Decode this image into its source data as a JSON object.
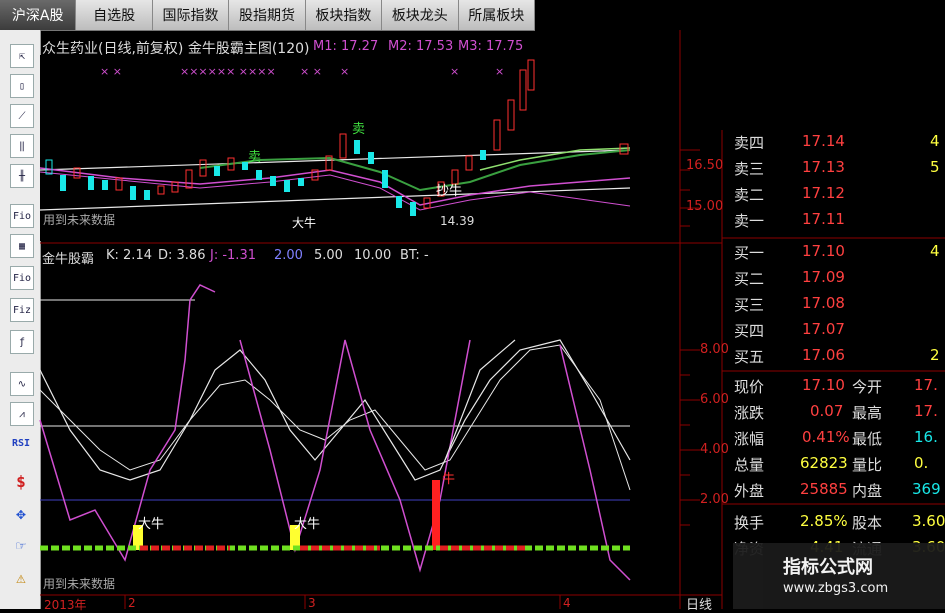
{
  "tabs": [
    "沪深A股",
    "自选股",
    "国际指数",
    "股指期货",
    "板块指数",
    "板块龙头",
    "所属板块"
  ],
  "toolbar": {
    "fio1": "Fio",
    "fio2": "Fio",
    "fiz": "Fiz",
    "rsi": "RSI"
  },
  "main_chart": {
    "title": "众生药业(日线,前复权) 金牛股霸主图(120)",
    "m1": "M1: 17.27",
    "m2": "M2: 17.53",
    "m3": "M3: 17.75",
    "axis_labels": [
      "16.50",
      "15.00"
    ],
    "marker_sell1": "卖",
    "marker_sell2": "卖",
    "marker_buy": "抄牛",
    "marker_big_bull": "大牛",
    "low_price": "14.39",
    "future_note": "用到未来数据"
  },
  "indicator": {
    "name": "金牛股霸",
    "k": "K: 2.14",
    "d": "D: 3.86",
    "j": "J: -1.31",
    "v2": "2.00",
    "v5": "5.00",
    "v10": "10.00",
    "bt": "BT: -",
    "axis_labels": [
      "8.00",
      "6.00",
      "4.00",
      "2.00"
    ],
    "signals": [
      "大牛",
      "大牛",
      "牛"
    ],
    "future_note": "用到未来数据"
  },
  "date_axis": {
    "year": "2013年",
    "m2": "2",
    "m3": "3",
    "m4": "4",
    "period": "日线"
  },
  "quote": {
    "asks": [
      {
        "label": "卖四",
        "price": "17.14",
        "vol": "4"
      },
      {
        "label": "卖三",
        "price": "17.13",
        "vol": "5"
      },
      {
        "label": "卖二",
        "price": "17.12",
        "vol": ""
      },
      {
        "label": "卖一",
        "price": "17.11",
        "vol": ""
      }
    ],
    "bids": [
      {
        "label": "买一",
        "price": "17.10",
        "vol": "4"
      },
      {
        "label": "买二",
        "price": "17.09",
        "vol": ""
      },
      {
        "label": "买三",
        "price": "17.08",
        "vol": ""
      },
      {
        "label": "买四",
        "price": "17.07",
        "vol": ""
      },
      {
        "label": "买五",
        "price": "17.06",
        "vol": "2"
      }
    ],
    "stats": [
      {
        "l1": "现价",
        "v1": "17.10",
        "l2": "今开",
        "v2": "17."
      },
      {
        "l1": "涨跌",
        "v1": "0.07",
        "l2": "最高",
        "v2": "17."
      },
      {
        "l1": "涨幅",
        "v1": "0.41%",
        "l2": "最低",
        "v2": "16."
      },
      {
        "l1": "总量",
        "v1": "62823",
        "l2": "量比",
        "v2": "0."
      },
      {
        "l1": "外盘",
        "v1": "25885",
        "l2": "内盘",
        "v2": "369"
      },
      {
        "l1": "换手",
        "v1": "2.85%",
        "l2": "股本",
        "v2": "3.60"
      },
      {
        "l1": "净资",
        "v1": "4.41",
        "l2": "流通",
        "v2": "3.60"
      }
    ]
  },
  "watermark": {
    "title": "指标公式网",
    "url": "www.zbgs3.com"
  },
  "colors": {
    "up": "#ff3030",
    "down": "#19e8e8",
    "purple": "#d04fd0",
    "green": "#70e020",
    "yellow": "#ffff30",
    "grid": "#8b0000"
  }
}
